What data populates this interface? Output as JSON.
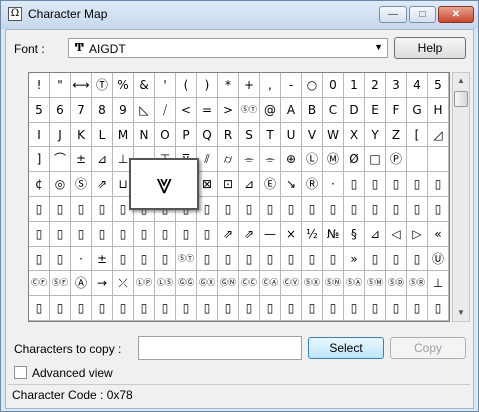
{
  "window": {
    "title": "Character Map",
    "controls": {
      "minimize": "—",
      "maximize": "□",
      "close": "✕"
    }
  },
  "font": {
    "label": "Font :",
    "selected": "AIGDT"
  },
  "buttons": {
    "help": "Help",
    "select": "Select",
    "copy": "Copy"
  },
  "grid": {
    "rows": [
      [
        "!",
        "\"",
        "⟷",
        "Ⓣ",
        "%",
        "&",
        "'",
        "(",
        ")",
        "*",
        "+",
        ",",
        "-",
        "○",
        "0",
        "1",
        "2",
        "3",
        "4",
        "5"
      ],
      [
        "5",
        "6",
        "7",
        "8",
        "9",
        "◺",
        "⧸",
        "<",
        "=",
        ">",
        "ⓈⓉ",
        "@",
        "A",
        "B",
        "C",
        "D",
        "E",
        "F",
        "G",
        "H"
      ],
      [
        "I",
        "J",
        "K",
        "L",
        "M",
        "N",
        "O",
        "P",
        "Q",
        "R",
        "S",
        "T",
        "U",
        "V",
        "W",
        "X",
        "Y",
        "Z",
        "[",
        "◿"
      ],
      [
        "]",
        "⌒",
        "±",
        "⊿",
        "⊥",
        "⌴",
        "⊤",
        "⊽",
        "⫽",
        "⌭",
        "⌯",
        "⌯",
        "⊕",
        "Ⓛ",
        "Ⓜ",
        "Ø",
        "□",
        "Ⓟ",
        "",
        ""
      ],
      [
        "¢",
        "◎",
        "Ⓢ",
        "⇗",
        "⊔",
        "⊓",
        "⊼",
        "⊽",
        "⊠",
        "⊡",
        "⊿",
        "Ⓔ",
        "↘",
        "Ⓡ",
        "·",
        "▯",
        "▯",
        "▯",
        "▯",
        "▯"
      ],
      [
        "▯",
        "▯",
        "▯",
        "▯",
        "▯",
        "▯",
        "▯",
        "▯",
        "▯",
        "▯",
        "▯",
        "▯",
        "▯",
        "▯",
        "▯",
        "▯",
        "▯",
        "▯",
        "▯",
        "▯"
      ],
      [
        "▯",
        "▯",
        "▯",
        "▯",
        "▯",
        "▯",
        "▯",
        "▯",
        "▯",
        "⇗",
        "⇗",
        "—",
        "×",
        "½",
        "№",
        "§",
        "⊿",
        "◁",
        "▷",
        "«"
      ],
      [
        "▯",
        "▯",
        "·",
        "±",
        "▯",
        "▯",
        "▯",
        "ⓈⓉ",
        "▯",
        "▯",
        "▯",
        "▯",
        "▯",
        "▯",
        "▯",
        "»",
        "▯",
        "▯",
        "▯",
        "Ⓤ"
      ],
      [
        "ⒸⒻ",
        "ⓈⒻ",
        "Ⓐ",
        "→",
        "⤫",
        "ⓁⓅ",
        "ⓁⓈ",
        "ⒼⒼ",
        "ⒼⓍ",
        "ⒼⓃ",
        "ⒸⒸ",
        "ⒸⒶ",
        "ⒸⓋ",
        "ⓈⓍ",
        "ⓈⓃ",
        "ⓈⒶ",
        "ⓈⓂ",
        "ⓈⒹ",
        "ⓈⓇ",
        "⊥"
      ],
      [
        "▯",
        "▯",
        "▯",
        "▯",
        "▯",
        "▯",
        "▯",
        "▯",
        "▯",
        "▯",
        "▯",
        "▯",
        "▯",
        "▯",
        "▯",
        "▯",
        "▯",
        "▯",
        "▯",
        "▯"
      ]
    ],
    "zoom_char": "⩔"
  },
  "copy": {
    "label": "Characters to copy :",
    "value": ""
  },
  "advanced": {
    "label": "Advanced view",
    "checked": false
  },
  "status": {
    "text": "Character Code : 0x78"
  }
}
